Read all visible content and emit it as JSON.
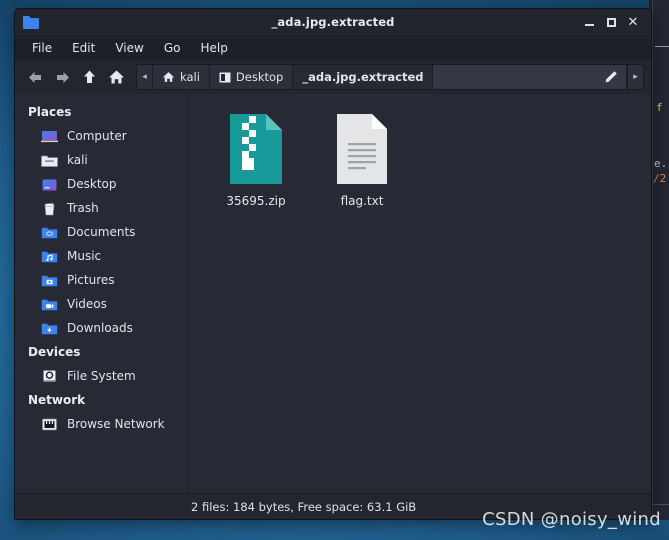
{
  "window": {
    "title": "_ada.jpg.extracted",
    "icon": "folder-icon",
    "buttons": {
      "minimize": "minimize",
      "maximize": "maximize",
      "close": "close"
    }
  },
  "menubar": {
    "items": [
      {
        "label": "File"
      },
      {
        "label": "Edit"
      },
      {
        "label": "View"
      },
      {
        "label": "Go"
      },
      {
        "label": "Help"
      }
    ]
  },
  "toolbar": {
    "nav": [
      {
        "name": "back-button",
        "icon": "arrow-left-icon"
      },
      {
        "name": "forward-button",
        "icon": "arrow-right-icon"
      },
      {
        "name": "up-button",
        "icon": "arrow-up-icon"
      },
      {
        "name": "home-button",
        "icon": "home-icon"
      }
    ],
    "scroll_left": "◂",
    "scroll_right": "▸",
    "path_entry_value": "",
    "path_entry_placeholder": "",
    "edit_icon": "pencil-icon"
  },
  "breadcrumbs": [
    {
      "label": "kali",
      "icon": "home-icon",
      "active": false
    },
    {
      "label": "Desktop",
      "icon": "desktop-folder-icon",
      "active": false
    },
    {
      "label": "_ada.jpg.extracted",
      "icon": "",
      "active": true
    }
  ],
  "sidebar": {
    "groups": [
      {
        "title": "Places",
        "items": [
          {
            "label": "Computer",
            "icon": "computer-icon"
          },
          {
            "label": "kali",
            "icon": "home-folder-icon"
          },
          {
            "label": "Desktop",
            "icon": "desktop-icon"
          },
          {
            "label": "Trash",
            "icon": "trash-icon"
          },
          {
            "label": "Documents",
            "icon": "documents-folder-icon"
          },
          {
            "label": "Music",
            "icon": "music-folder-icon"
          },
          {
            "label": "Pictures",
            "icon": "pictures-folder-icon"
          },
          {
            "label": "Videos",
            "icon": "videos-folder-icon"
          },
          {
            "label": "Downloads",
            "icon": "downloads-folder-icon"
          }
        ]
      },
      {
        "title": "Devices",
        "items": [
          {
            "label": "File System",
            "icon": "drive-icon"
          }
        ]
      },
      {
        "title": "Network",
        "items": [
          {
            "label": "Browse Network",
            "icon": "network-icon"
          }
        ]
      }
    ]
  },
  "files": [
    {
      "label": "35695.zip",
      "icon": "archive-file-icon"
    },
    {
      "label": "flag.txt",
      "icon": "text-file-icon"
    }
  ],
  "statusbar": {
    "text": "2 files: 184 bytes, Free space: 63.1 GiB"
  },
  "watermark": {
    "text": "CSDN @noisy_wind"
  },
  "background_window": {
    "fragment_1": "f",
    "fragment_2": "e.",
    "fragment_3": "/2"
  },
  "colors": {
    "desktop": "#2a74a8",
    "window_bg": "#272a35",
    "titlebar": "#22252e",
    "menubar": "#1d2029",
    "toolbar": "#23262f",
    "accent_folder": "#3b84f0",
    "archive_teal": "#189a9a",
    "text": "#e2e6ed"
  }
}
